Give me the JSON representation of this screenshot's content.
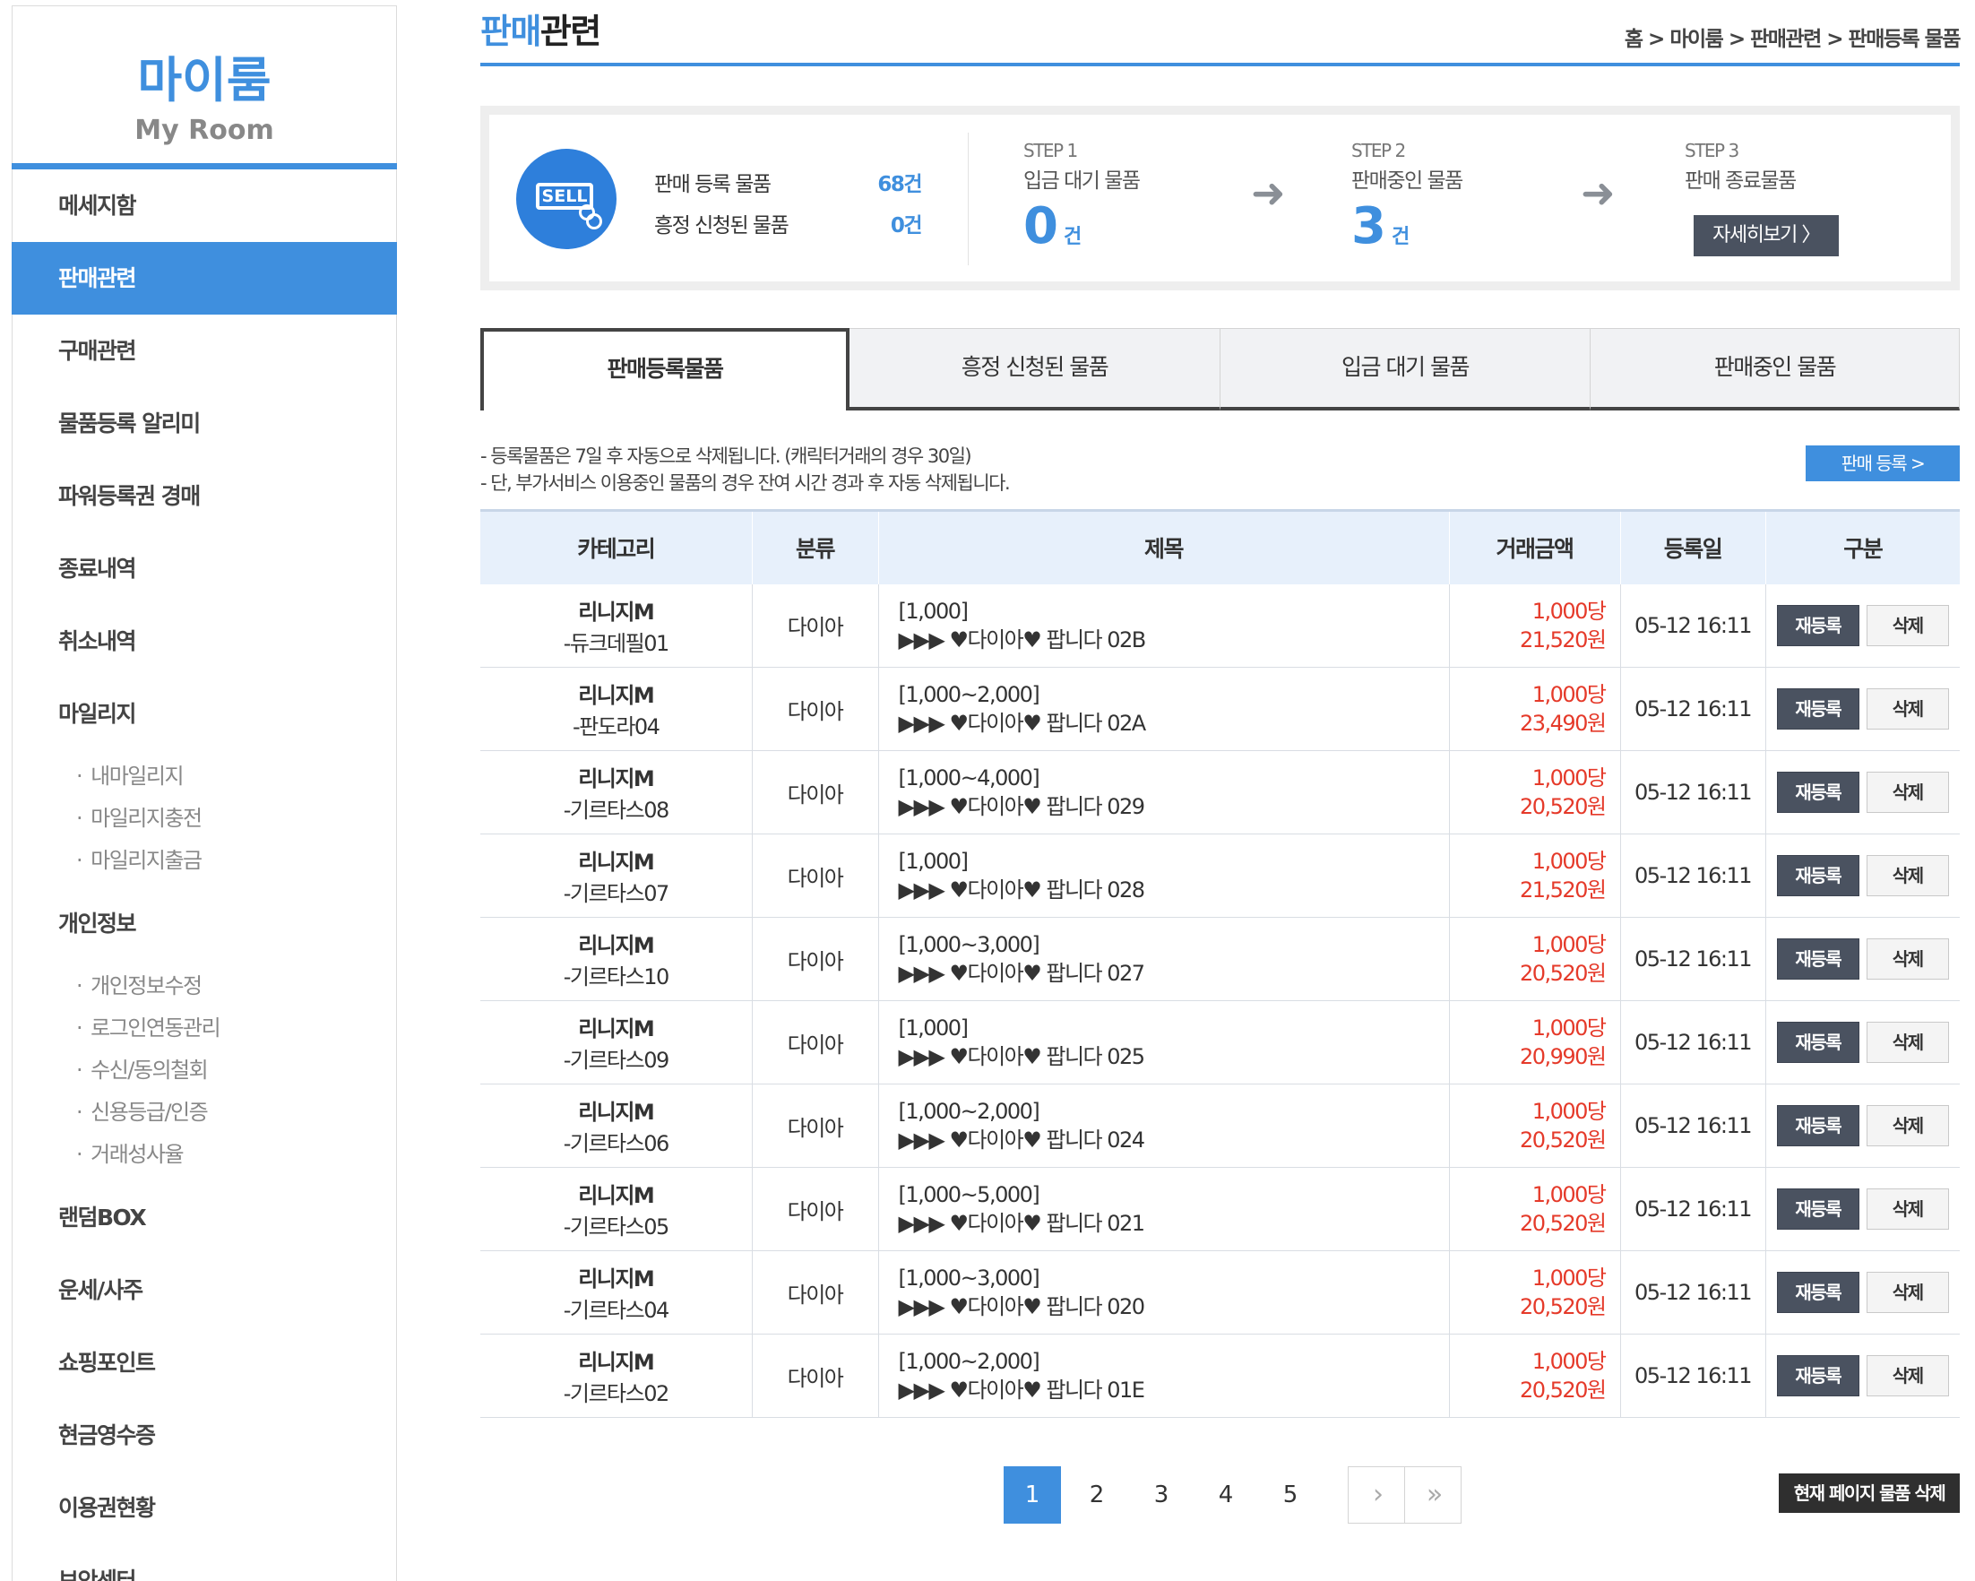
{
  "sidebar": {
    "logo_ko": "마이룸",
    "logo_en": "My Room",
    "items": [
      {
        "label": "메세지함"
      },
      {
        "label": "판매관련"
      },
      {
        "label": "구매관련"
      },
      {
        "label": "물품등록 알리미"
      },
      {
        "label": "파워등록권 경매"
      },
      {
        "label": "종료내역"
      },
      {
        "label": "취소내역"
      },
      {
        "label": "마일리지"
      },
      {
        "label": "개인정보"
      },
      {
        "label": "랜덤BOX"
      },
      {
        "label": "운세/사주"
      },
      {
        "label": "쇼핑포인트"
      },
      {
        "label": "현금영수증"
      },
      {
        "label": "이용권현황"
      },
      {
        "label": "보안센터"
      }
    ],
    "mileage_sub": [
      "내마일리지",
      "마일리지충전",
      "마일리지출금"
    ],
    "personal_sub": [
      "개인정보수정",
      "로그인연동관리",
      "수신/동의철회",
      "신용등급/인증",
      "거래성사율"
    ]
  },
  "header": {
    "title_accent": "판매",
    "title_rest": "관련",
    "breadcrumb": "홈 > 마이룸 > 판매관련 > 판매등록 물품"
  },
  "summary": {
    "icon_text": "SELL",
    "registered_label": "판매 등록 물품",
    "registered_value": "68건",
    "bargain_label": "흥정 신청된 물품",
    "bargain_value": "0건",
    "step1_label": "STEP 1",
    "step1_name": "입금 대기 물품",
    "step1_count": "0",
    "step2_label": "STEP 2",
    "step2_name": "판매중인 물품",
    "step2_count": "3",
    "step3_label": "STEP 3",
    "step3_name": "판매 종료물품",
    "count_unit": "건",
    "arrow": "➜",
    "detail_button": "자세히보기 〉"
  },
  "tabs": [
    "판매등록물품",
    "흥정 신청된 물품",
    "입금 대기 물품",
    "판매중인 물품"
  ],
  "notice": {
    "line1": "- 등록물품은 7일 후 자동으로 삭제됩니다. (캐릭터거래의 경우 30일)",
    "line2": "- 단, 부가서비스 이용중인 물품의 경우 잔여 시간 경과 후 자동 삭제됩니다."
  },
  "register_button": "판매 등록 >",
  "table": {
    "headers": [
      "카테고리",
      "분류",
      "제목",
      "거래금액",
      "등록일",
      "구분"
    ],
    "rows": [
      {
        "game": "리니지M",
        "server": "-듀크데필01",
        "type": "다이아",
        "range": "[1,000]",
        "title": "▶▶▶ ♥다이아♥ 팝니다 02B",
        "unit": "1,000당",
        "price": "21,520원",
        "date": "05-12 16:11"
      },
      {
        "game": "리니지M",
        "server": "-판도라04",
        "type": "다이아",
        "range": "[1,000~2,000]",
        "title": "▶▶▶ ♥다이아♥ 팝니다 02A",
        "unit": "1,000당",
        "price": "23,490원",
        "date": "05-12 16:11"
      },
      {
        "game": "리니지M",
        "server": "-기르타스08",
        "type": "다이아",
        "range": "[1,000~4,000]",
        "title": "▶▶▶ ♥다이아♥ 팝니다 029",
        "unit": "1,000당",
        "price": "20,520원",
        "date": "05-12 16:11"
      },
      {
        "game": "리니지M",
        "server": "-기르타스07",
        "type": "다이아",
        "range": "[1,000]",
        "title": "▶▶▶ ♥다이아♥ 팝니다 028",
        "unit": "1,000당",
        "price": "21,520원",
        "date": "05-12 16:11"
      },
      {
        "game": "리니지M",
        "server": "-기르타스10",
        "type": "다이아",
        "range": "[1,000~3,000]",
        "title": "▶▶▶ ♥다이아♥ 팝니다 027",
        "unit": "1,000당",
        "price": "20,520원",
        "date": "05-12 16:11"
      },
      {
        "game": "리니지M",
        "server": "-기르타스09",
        "type": "다이아",
        "range": "[1,000]",
        "title": "▶▶▶ ♥다이아♥ 팝니다 025",
        "unit": "1,000당",
        "price": "20,990원",
        "date": "05-12 16:11"
      },
      {
        "game": "리니지M",
        "server": "-기르타스06",
        "type": "다이아",
        "range": "[1,000~2,000]",
        "title": "▶▶▶ ♥다이아♥ 팝니다 024",
        "unit": "1,000당",
        "price": "20,520원",
        "date": "05-12 16:11"
      },
      {
        "game": "리니지M",
        "server": "-기르타스05",
        "type": "다이아",
        "range": "[1,000~5,000]",
        "title": "▶▶▶ ♥다이아♥ 팝니다 021",
        "unit": "1,000당",
        "price": "20,520원",
        "date": "05-12 16:11"
      },
      {
        "game": "리니지M",
        "server": "-기르타스04",
        "type": "다이아",
        "range": "[1,000~3,000]",
        "title": "▶▶▶ ♥다이아♥ 팝니다 020",
        "unit": "1,000당",
        "price": "20,520원",
        "date": "05-12 16:11"
      },
      {
        "game": "리니지M",
        "server": "-기르타스02",
        "type": "다이아",
        "range": "[1,000~2,000]",
        "title": "▶▶▶ ♥다이아♥ 팝니다 01E",
        "unit": "1,000당",
        "price": "20,520원",
        "date": "05-12 16:11"
      }
    ],
    "reregister_label": "재등록",
    "delete_label": "삭제"
  },
  "pagination": {
    "pages": [
      "1",
      "2",
      "3",
      "4",
      "5"
    ],
    "current": "1",
    "next": "›",
    "last": "»"
  },
  "bulk_delete_button": "현재 페이지 물품 삭제",
  "colors": {
    "accent": "#3f8fde",
    "price": "#e53a2a",
    "dark_button": "#4a5260"
  }
}
